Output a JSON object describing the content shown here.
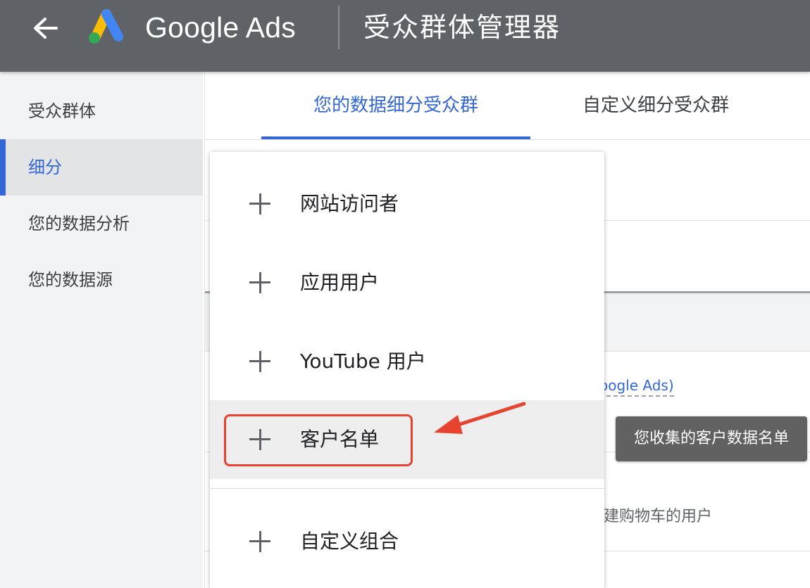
{
  "header": {
    "back_icon": "arrow-left-icon",
    "logo_name": "Google Ads",
    "title": "受众群体管理器",
    "colors": {
      "bar": "#5f6368",
      "logo_blue": "#4285f4",
      "logo_yellow": "#fbbc04",
      "logo_green": "#34a853"
    }
  },
  "sidebar": {
    "items": [
      {
        "label": "受众群体",
        "active": false
      },
      {
        "label": "细分",
        "active": true
      },
      {
        "label": "您的数据分析",
        "active": false
      },
      {
        "label": "您的数据源",
        "active": false
      }
    ],
    "accent": "#3367d6"
  },
  "tabs": [
    {
      "label": "您的数据细分受众群",
      "active": true
    },
    {
      "label": "自定义细分受众群",
      "active": false
    }
  ],
  "background": {
    "link_fragment": "oogle Ads)",
    "text_fragment": "建购物车的用户"
  },
  "dropdown": {
    "items": [
      {
        "icon": "plus-icon",
        "label": "网站访问者"
      },
      {
        "icon": "plus-icon",
        "label": "应用用户"
      },
      {
        "icon": "plus-icon",
        "label": "YouTube 用户"
      },
      {
        "icon": "plus-icon",
        "label": "客户名单",
        "hovered": true
      },
      {
        "icon": "plus-icon",
        "label": "自定义组合"
      }
    ]
  },
  "tooltip": {
    "text": "您收集的客户数据名单"
  },
  "annotation": {
    "color": "#e8432e"
  }
}
